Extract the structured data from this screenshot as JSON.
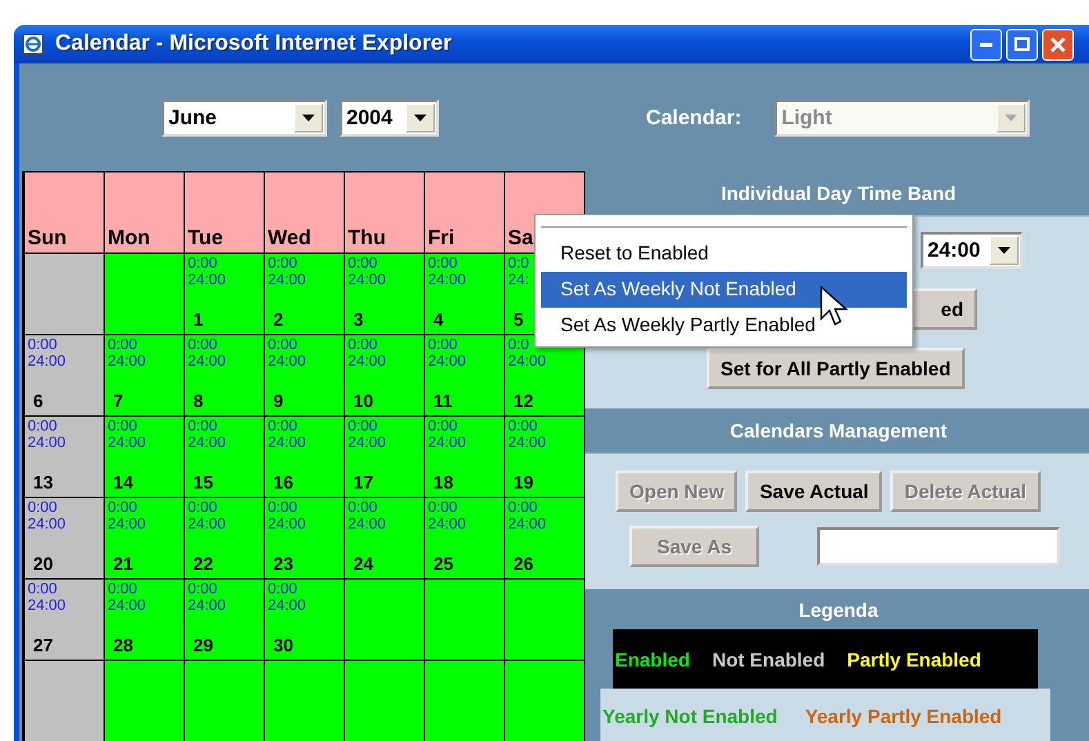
{
  "window": {
    "title": "Calendar - Microsoft Internet Explorer"
  },
  "toolbar": {
    "month": "June",
    "year": "2004",
    "calendar_label": "Calendar:",
    "calendar": {
      "value": "Light",
      "disabled": true
    }
  },
  "calendar": {
    "weekdays": [
      "Sun",
      "Mon",
      "Tue",
      "Wed",
      "Thu",
      "Fri",
      "Sa"
    ],
    "weeks": [
      [
        {
          "enabled": false
        },
        {
          "enabled": true
        },
        {
          "enabled": true,
          "start": "0:00",
          "end": "24:00",
          "day": "1"
        },
        {
          "enabled": true,
          "start": "0:00",
          "end": "24:00",
          "day": "2"
        },
        {
          "enabled": true,
          "start": "0:00",
          "end": "24:00",
          "day": "3"
        },
        {
          "enabled": true,
          "start": "0:00",
          "end": "24:00",
          "day": "4"
        },
        {
          "enabled": true,
          "start": "0:0",
          "end": "24:",
          "day": "5"
        }
      ],
      [
        {
          "enabled": false,
          "start": "0:00",
          "end": "24:00",
          "day": "6"
        },
        {
          "enabled": true,
          "start": "0:00",
          "end": "24:00",
          "day": "7"
        },
        {
          "enabled": true,
          "start": "0:00",
          "end": "24:00",
          "day": "8"
        },
        {
          "enabled": true,
          "start": "0:00",
          "end": "24:00",
          "day": "9"
        },
        {
          "enabled": true,
          "start": "0:00",
          "end": "24:00",
          "day": "10"
        },
        {
          "enabled": true,
          "start": "0:00",
          "end": "24:00",
          "day": "11"
        },
        {
          "enabled": true,
          "start": "0:0",
          "end": "24:00",
          "day": "12"
        }
      ],
      [
        {
          "enabled": false,
          "start": "0:00",
          "end": "24:00",
          "day": "13"
        },
        {
          "enabled": true,
          "start": "0:00",
          "end": "24:00",
          "day": "14"
        },
        {
          "enabled": true,
          "start": "0:00",
          "end": "24:00",
          "day": "15"
        },
        {
          "enabled": true,
          "start": "0:00",
          "end": "24:00",
          "day": "16"
        },
        {
          "enabled": true,
          "start": "0:00",
          "end": "24:00",
          "day": "17"
        },
        {
          "enabled": true,
          "start": "0:00",
          "end": "24:00",
          "day": "18"
        },
        {
          "enabled": true,
          "start": "0:00",
          "end": "24:00",
          "day": "19"
        }
      ],
      [
        {
          "enabled": false,
          "start": "0:00",
          "end": "24:00",
          "day": "20"
        },
        {
          "enabled": true,
          "start": "0:00",
          "end": "24:00",
          "day": "21"
        },
        {
          "enabled": true,
          "start": "0:00",
          "end": "24:00",
          "day": "22"
        },
        {
          "enabled": true,
          "start": "0:00",
          "end": "24:00",
          "day": "23"
        },
        {
          "enabled": true,
          "start": "0:00",
          "end": "24:00",
          "day": "24"
        },
        {
          "enabled": true,
          "start": "0:00",
          "end": "24:00",
          "day": "25"
        },
        {
          "enabled": true,
          "start": "0:00",
          "end": "24:00",
          "day": "26"
        }
      ],
      [
        {
          "enabled": false,
          "start": "0:00",
          "end": "24:00",
          "day": "27"
        },
        {
          "enabled": true,
          "start": "0:00",
          "end": "24:00",
          "day": "28"
        },
        {
          "enabled": true,
          "start": "0:00",
          "end": "24:00",
          "day": "29"
        },
        {
          "enabled": true,
          "start": "0:00",
          "end": "24:00",
          "day": "30"
        },
        {
          "enabled": true
        },
        {
          "enabled": true
        },
        {
          "enabled": true
        }
      ],
      [
        {
          "enabled": false
        },
        {
          "enabled": true
        },
        {
          "enabled": true
        },
        {
          "enabled": true
        },
        {
          "enabled": true
        },
        {
          "enabled": true
        },
        {
          "enabled": true
        }
      ]
    ]
  },
  "day_time_band": {
    "title": "Individual Day Time Band",
    "end_time": "24:00",
    "buttons": [
      "ed",
      "Set for All Partly Enabled"
    ]
  },
  "calendars_management": {
    "title": "Calendars Management",
    "buttons": [
      {
        "label": "Open New",
        "disabled": true
      },
      {
        "label": "Save Actual",
        "disabled": false
      },
      {
        "label": "Delete Actual",
        "disabled": true
      }
    ],
    "save_as": {
      "label": "Save As",
      "disabled": true
    }
  },
  "legend": {
    "title": "Legenda",
    "primary": [
      {
        "label": "Enabled",
        "color": "#00ee00"
      },
      {
        "label": "Not Enabled",
        "color": "#c8c8c8"
      },
      {
        "label": "Partly Enabled",
        "color": "#ffff00"
      }
    ],
    "secondary": [
      {
        "label": "Yearly Not Enabled",
        "color": "#22aa22"
      },
      {
        "label": "Yearly Partly Enabled",
        "color": "#cc6611"
      }
    ]
  },
  "context_menu": {
    "items": [
      {
        "label": "Reset to Enabled",
        "selected": false
      },
      {
        "label": "Set As Weekly Not Enabled",
        "selected": true
      },
      {
        "label": "Set As Weekly Partly Enabled",
        "selected": false
      }
    ]
  }
}
